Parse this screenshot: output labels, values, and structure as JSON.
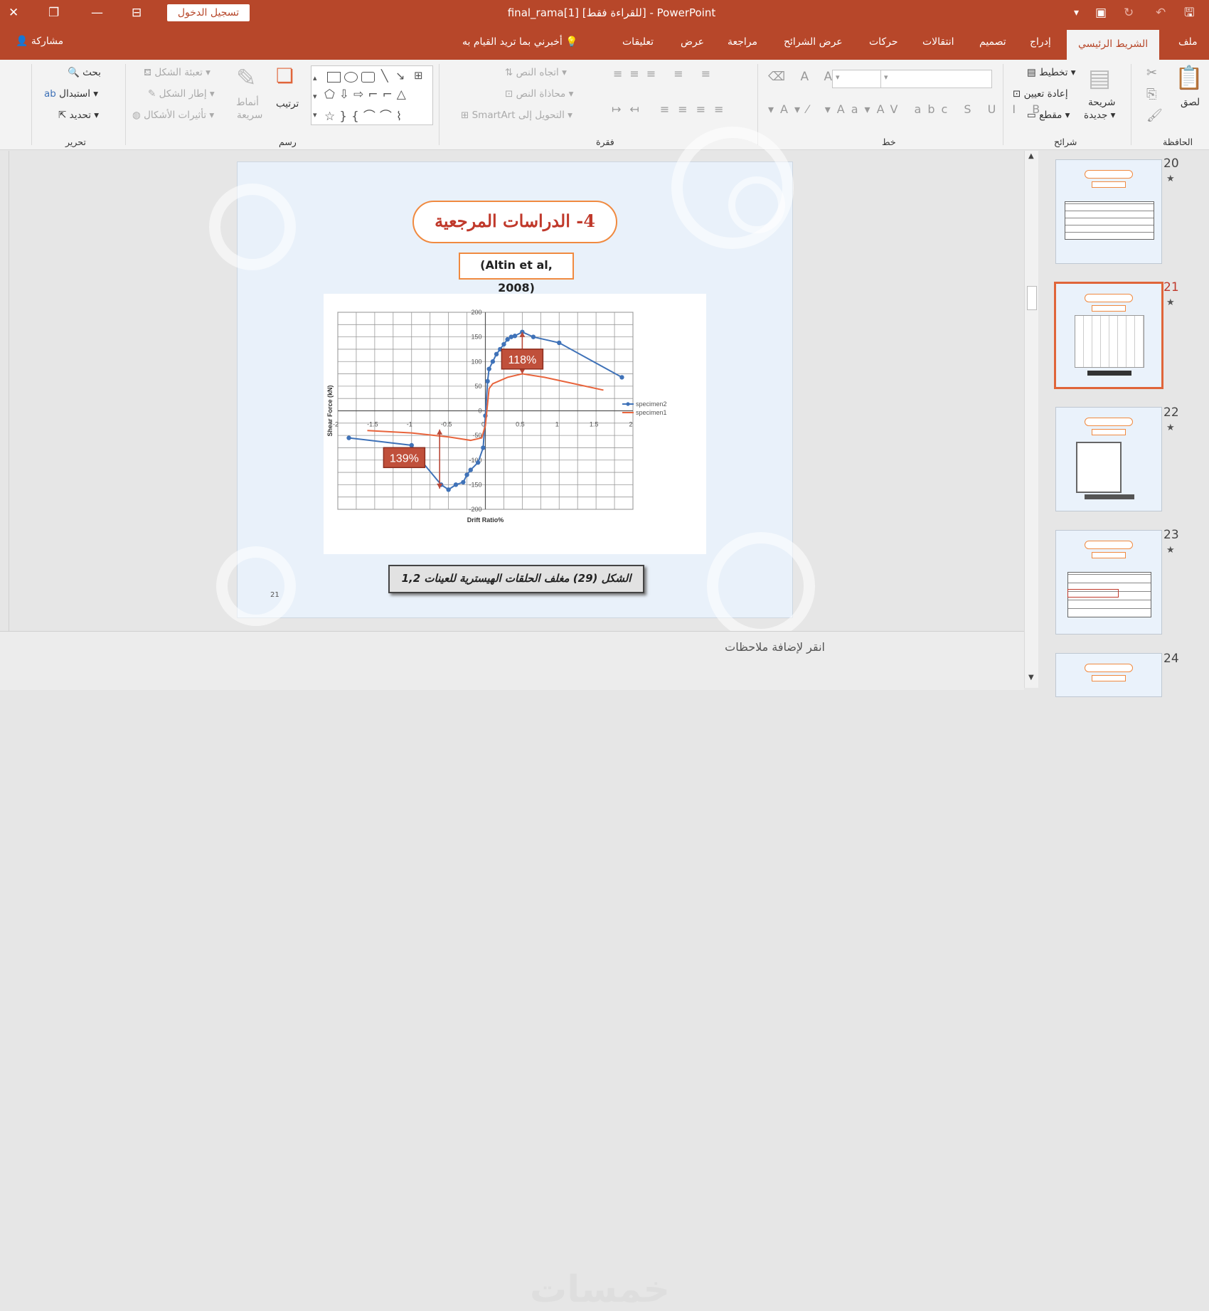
{
  "window": {
    "title": "PowerPoint - [للقراءة فقط] final_rama[1]",
    "signin_label": "تسجيل الدخول"
  },
  "tabs": {
    "file": "ملف",
    "home": "الشريط الرئيسي",
    "insert": "إدراج",
    "design": "تصميم",
    "transitions": "انتقالات",
    "animations": "حركات",
    "slideshow": "عرض الشرائح",
    "review": "مراجعة",
    "view": "عرض",
    "comments": "تعليقات",
    "tellme": "أخبرني بما تريد القيام به",
    "share": "مشاركة"
  },
  "ribbon": {
    "groups": {
      "clipboard": "الحافظة",
      "slides": "شرائح",
      "font": "خط",
      "paragraph": "فقرة",
      "drawing": "رسم",
      "editing": "تحرير"
    },
    "clipboard": {
      "paste": "لصق"
    },
    "slides": {
      "new_slide_1": "شريحة",
      "new_slide_2": "جديدة",
      "layout": "تخطيط",
      "reset": "إعادة تعيين",
      "section": "مقطع"
    },
    "paragraph": {
      "text_direction": "اتجاه النص",
      "align_text": "محاذاة النص",
      "smartart": "التحويل إلى SmartArt"
    },
    "drawing": {
      "arrange": "ترتيب",
      "quick_styles_1": "أنماط",
      "quick_styles_2": "سريعة",
      "fill": "تعبئة الشكل",
      "outline": "إطار الشكل",
      "effects": "تأثيرات الأشكال"
    },
    "editing": {
      "find": "بحث",
      "replace": "استبدال",
      "select": "تحديد"
    }
  },
  "slide": {
    "title": "4- الدراسات المرجعية",
    "citation": "(Altin et al, 2008)",
    "caption": "الشكل (29) مغلف الحلقات الهيسترية للعينات 1,2",
    "number": "21"
  },
  "chart_data": {
    "type": "scatter",
    "xlabel": "Drift Ratio%",
    "ylabel": "Shear Force (kN)",
    "xlim": [
      -2,
      2
    ],
    "ylim": [
      -200,
      200
    ],
    "x_ticks": [
      -2,
      -1.5,
      -1,
      -0.5,
      0,
      0.5,
      1,
      1.5,
      2
    ],
    "y_ticks": [
      -200,
      -150,
      -100,
      -50,
      0,
      50,
      100,
      150,
      200
    ],
    "x_tick_labels": [
      "-2",
      "-1.5",
      "-1",
      "-0.5",
      "0",
      "0.5",
      "1",
      "1.5",
      "2"
    ],
    "y_tick_labels": [
      "-200",
      "-150",
      "-100",
      "-50",
      "0",
      "50",
      "100",
      "150",
      "200"
    ],
    "grid": true,
    "legend_position": "right",
    "annotations": [
      {
        "text": "118%",
        "x": 0.5,
        "y": 105
      },
      {
        "text": "139%",
        "x": -1.1,
        "y": -95
      }
    ],
    "series": [
      {
        "name": "specimen2",
        "color": "#3f72b8",
        "markers": true,
        "x": [
          -1.85,
          -1.0,
          -0.85,
          -0.6,
          -0.5,
          -0.4,
          -0.3,
          -0.25,
          -0.2,
          -0.1,
          -0.03,
          0,
          0.03,
          0.05,
          0.1,
          0.15,
          0.2,
          0.25,
          0.3,
          0.35,
          0.4,
          0.5,
          0.65,
          1.0,
          1.85
        ],
        "y": [
          -55,
          -70,
          -105,
          -150,
          -160,
          -150,
          -145,
          -130,
          -120,
          -105,
          -75,
          -10,
          60,
          85,
          100,
          115,
          125,
          135,
          145,
          150,
          152,
          160,
          150,
          138,
          68
        ]
      },
      {
        "name": "specimen1",
        "color": "#e8643c",
        "markers": false,
        "x": [
          -1.6,
          -1.0,
          -0.5,
          -0.2,
          -0.05,
          0,
          0.05,
          0.1,
          0.3,
          0.5,
          0.8,
          1.2,
          1.6
        ],
        "y": [
          -40,
          -45,
          -53,
          -60,
          -55,
          -30,
          45,
          55,
          68,
          75,
          68,
          55,
          42
        ]
      }
    ]
  },
  "thumbnails": [
    {
      "num": "20",
      "star": "★"
    },
    {
      "num": "21",
      "star": "★"
    },
    {
      "num": "22",
      "star": "★"
    },
    {
      "num": "23",
      "star": "★"
    },
    {
      "num": "24",
      "star": ""
    }
  ],
  "notes": {
    "placeholder": "انقر لإضافة ملاحظات"
  },
  "watermark": "خمسات"
}
